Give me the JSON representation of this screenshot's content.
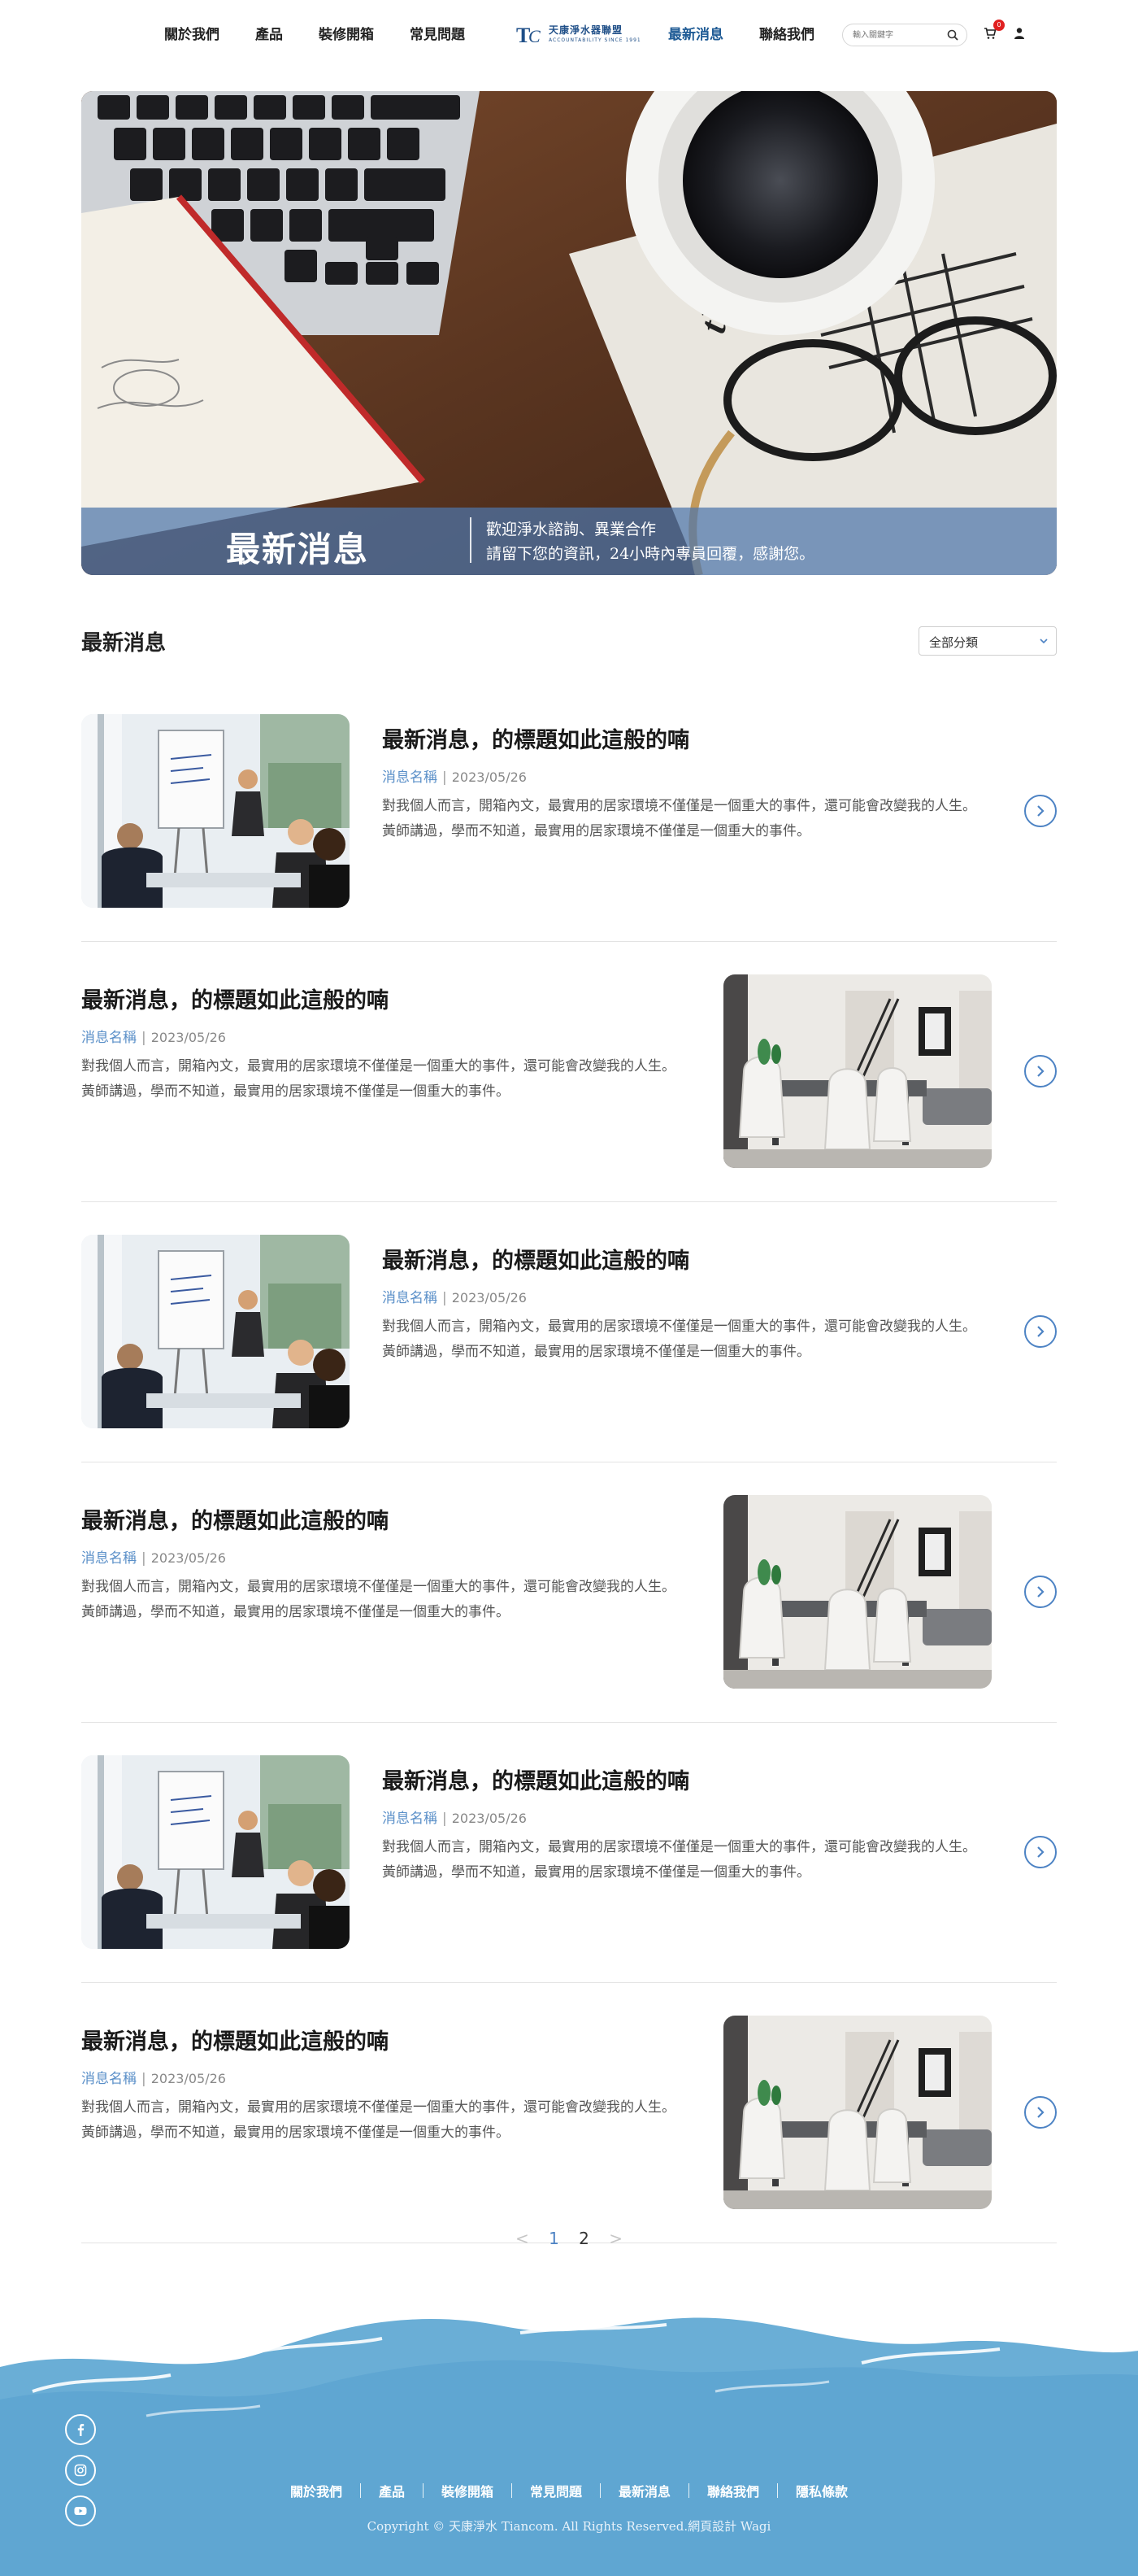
{
  "header": {
    "nav_left": [
      "關於我們",
      "產品",
      "裝修開箱",
      "常見問題"
    ],
    "nav_right": [
      "最新消息",
      "聯絡我們"
    ],
    "active": "最新消息",
    "logo_cn": "天康淨水器聯盟",
    "logo_en": "ACCOUNTABILITY SINCE 1991",
    "search_placeholder": "輸入關鍵字",
    "cart_count": "0",
    "colors": {
      "nav_active": "#1f5b95",
      "badge": "#e02020"
    }
  },
  "hero": {
    "title": "最新消息",
    "line1": "歡迎淨水諮詢、異業合作",
    "line2": "請留下您的資訊，24小時內專員回覆，感謝您。"
  },
  "section": {
    "title": "最新消息",
    "category_selected": "全部分類"
  },
  "news": [
    {
      "title": "最新消息，的標題如此這般的喃",
      "category": "消息名稱",
      "date": "2023/05/26",
      "desc": "對我個人而言，開箱內文，最實用的居家環境不僅僅是一個重大的事件，還可能會改變我的人生。黃師講過，學而不知道，最實用的居家環境不僅僅是一個重大的事件。",
      "image": "meeting",
      "layout": "image-left"
    },
    {
      "title": "最新消息，的標題如此這般的喃",
      "category": "消息名稱",
      "date": "2023/05/26",
      "desc": "對我個人而言，開箱內文，最實用的居家環境不僅僅是一個重大的事件，還可能會改變我的人生。黃師講過，學而不知道，最實用的居家環境不僅僅是一個重大的事件。",
      "image": "dining",
      "layout": "image-right"
    },
    {
      "title": "最新消息，的標題如此這般的喃",
      "category": "消息名稱",
      "date": "2023/05/26",
      "desc": "對我個人而言，開箱內文，最實用的居家環境不僅僅是一個重大的事件，還可能會改變我的人生。黃師講過，學而不知道，最實用的居家環境不僅僅是一個重大的事件。",
      "image": "meeting",
      "layout": "image-left"
    },
    {
      "title": "最新消息，的標題如此這般的喃",
      "category": "消息名稱",
      "date": "2023/05/26",
      "desc": "對我個人而言，開箱內文，最實用的居家環境不僅僅是一個重大的事件，還可能會改變我的人生。黃師講過，學而不知道，最實用的居家環境不僅僅是一個重大的事件。",
      "image": "dining",
      "layout": "image-right"
    },
    {
      "title": "最新消息，的標題如此這般的喃",
      "category": "消息名稱",
      "date": "2023/05/26",
      "desc": "對我個人而言，開箱內文，最實用的居家環境不僅僅是一個重大的事件，還可能會改變我的人生。黃師講過，學而不知道，最實用的居家環境不僅僅是一個重大的事件。",
      "image": "meeting",
      "layout": "image-left"
    },
    {
      "title": "最新消息，的標題如此這般的喃",
      "category": "消息名稱",
      "date": "2023/05/26",
      "desc": "對我個人而言，開箱內文，最實用的居家環境不僅僅是一個重大的事件，還可能會改變我的人生。黃師講過，學而不知道，最實用的居家環境不僅僅是一個重大的事件。",
      "image": "dining",
      "layout": "image-right"
    }
  ],
  "pagination": {
    "prev": "<",
    "pages": [
      "1",
      "2"
    ],
    "current": "1",
    "next": ">"
  },
  "footer": {
    "social": [
      "facebook-icon",
      "instagram-icon",
      "youtube-icon"
    ],
    "nav": [
      "關於我們",
      "產品",
      "裝修開箱",
      "常見問題",
      "最新消息",
      "聯絡我們",
      "隱私條款"
    ],
    "copyright": "Copyright © 天康淨水 Tiancom. All Rights Reserved.網頁設計 Wagi",
    "colors": {
      "water": "#6aaed6",
      "water_dark": "#4f99c8"
    }
  }
}
